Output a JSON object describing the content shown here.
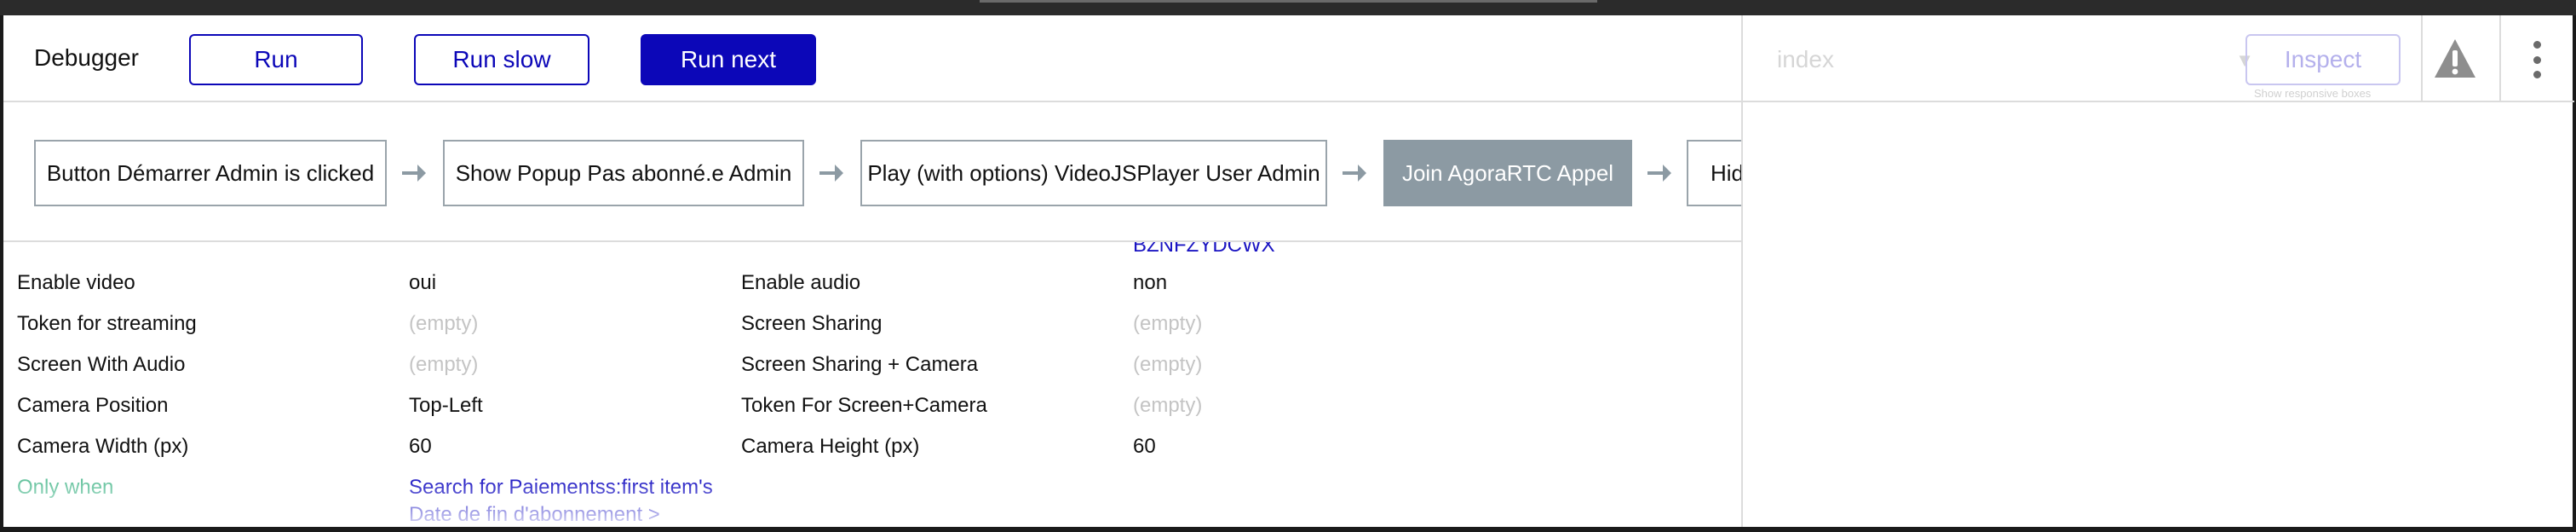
{
  "toolbar": {
    "title": "Debugger",
    "run_label": "Run",
    "run_slow_label": "Run slow",
    "run_next_label": "Run next"
  },
  "inspector": {
    "dropdown_value": "index",
    "inspect_label": "Inspect",
    "responsive_toggle": "Show responsive boxes"
  },
  "steps": [
    {
      "label": "Button Démarrer Admin is clicked",
      "active": false
    },
    {
      "label": "Show Popup Pas abonné.e Admin",
      "active": false
    },
    {
      "label": "Play (with options) VideoJSPlayer User Admin",
      "active": false
    },
    {
      "label": "Join AgoraRTC Appel",
      "active": true
    },
    {
      "label": "Hid",
      "active": false
    }
  ],
  "properties": {
    "cut_value": "BZNFZYDCWX",
    "rows": [
      {
        "label1": "Enable video",
        "value1": "oui",
        "label2": "Enable audio",
        "value2": "non"
      },
      {
        "label1": "Token for streaming",
        "value1": "(empty)",
        "label2": "Screen Sharing",
        "value2": "(empty)"
      },
      {
        "label1": "Screen With Audio",
        "value1": "(empty)",
        "label2": "Screen Sharing + Camera",
        "value2": "(empty)"
      },
      {
        "label1": "Camera Position",
        "value1": "Top-Left",
        "label2": "Token For Screen+Camera",
        "value2": "(empty)"
      },
      {
        "label1": "Camera Width (px)",
        "value1": "60",
        "label2": "Camera Height (px)",
        "value2": "60"
      }
    ],
    "only_when_label": "Only when",
    "only_when_value_line1": "Search for Paiementss:first item's",
    "only_when_value_line2": "Date de fin d'abonnement >"
  },
  "colors": {
    "accent": "#0c07b8",
    "active_step": "#8c9aa3",
    "empty_text": "#c4c4c4",
    "condition_green": "#5fc09a",
    "warning_icon": "#8e8e8e"
  }
}
